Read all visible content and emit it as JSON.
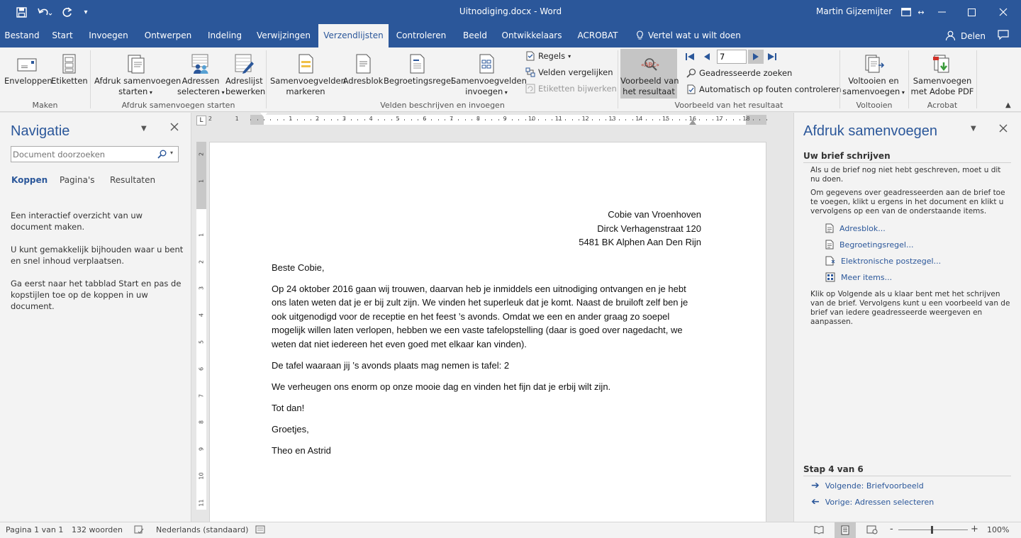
{
  "titlebar": {
    "doc_title": "Uitnodiging.docx - Word",
    "user": "Martin Gijzemijter",
    "icons": [
      "save-icon",
      "undo-icon",
      "redo-icon",
      "customize-qat-icon",
      "ribbon-display-icon",
      "resize-icon",
      "minimize-icon",
      "maximize-icon",
      "close-icon"
    ]
  },
  "tabs": {
    "items": [
      "Bestand",
      "Start",
      "Invoegen",
      "Ontwerpen",
      "Indeling",
      "Verwijzingen",
      "Verzendlijsten",
      "Controleren",
      "Beeld",
      "Ontwikkelaars",
      "ACROBAT"
    ],
    "active": "Verzendlijsten",
    "tell_me": "Vertel wat u wilt doen",
    "share": "Delen"
  },
  "ribbon": {
    "groups": {
      "maken": "Maken",
      "afdruk_starten": "Afdruk samenvoegen starten",
      "velden": "Velden beschrijven en invoegen",
      "voorbeeld": "Voorbeeld van het resultaat",
      "voltooien": "Voltooien",
      "acrobat": "Acrobat"
    },
    "buttons": {
      "enveloppen": "Enveloppen",
      "etiketten": "Etiketten",
      "afdruk_l1": "Afdruk samenvoegen",
      "afdruk_l2": "starten",
      "adressen_l1": "Adressen",
      "adressen_l2": "selecteren",
      "adreslijst_l1": "Adreslijst",
      "adreslijst_l2": "bewerken",
      "markeren_l1": "Samenvoegvelden",
      "markeren_l2": "markeren",
      "adresblok": "Adresblok",
      "begroetingsregel": "Begroetingsregel",
      "invoegen_l1": "Samenvoegvelden",
      "invoegen_l2": "invoegen",
      "regels": "Regels",
      "velden_vergelijken": "Velden vergelijken",
      "etiketten_bijwerken": "Etiketten bijwerken",
      "voorbeeld_l1": "Voorbeeld van",
      "voorbeeld_l2": "het resultaat",
      "record_value": "7",
      "geadresseerde_zoeken": "Geadresseerde zoeken",
      "auto_controleren": "Automatisch op fouten controleren",
      "voltooien_l1": "Voltooien en",
      "voltooien_l2": "samenvoegen",
      "pdf_l1": "Samenvoegen",
      "pdf_l2": "met Adobe PDF"
    }
  },
  "navigation": {
    "title": "Navigatie",
    "search_placeholder": "Document doorzoeken",
    "tabs": [
      "Koppen",
      "Pagina's",
      "Resultaten"
    ],
    "active_tab": "Koppen",
    "text1": "Een interactief overzicht van uw document maken.",
    "text2": "U kunt gemakkelijk bijhouden waar u bent en snel inhoud verplaatsen.",
    "text3": "Ga eerst naar het tabblad Start en pas de kopstijlen toe op de koppen in uw document."
  },
  "ruler": {
    "marks": [
      "2",
      "1",
      "1",
      "2",
      "3",
      "4",
      "5",
      "6",
      "7",
      "8",
      "9",
      "10",
      "11",
      "12",
      "13",
      "14",
      "15",
      "16",
      "17",
      "18"
    ],
    "v_marks": [
      "2",
      "1",
      "1",
      "2",
      "3",
      "4",
      "5",
      "6",
      "7",
      "8",
      "9",
      "10",
      "11"
    ]
  },
  "letter": {
    "address": [
      "Cobie van Vroenhoven",
      "Dirck Verhagenstraat 120",
      "5481 BK  Alphen Aan Den Rijn"
    ],
    "greeting": "Beste Cobie,",
    "para1": "Op 24 oktober 2016 gaan wij trouwen, daarvan heb je inmiddels een uitnodiging ontvangen en je hebt ons laten weten dat je er bij zult zijn. We vinden het superleuk dat je komt. Naast de bruiloft zelf ben je ook uitgenodigd voor de receptie en het feest ’s avonds. Omdat we een en ander graag zo soepel mogelijk willen laten verlopen, hebben we een vaste tafelopstelling (daar is goed over nagedacht, we weten dat niet iedereen het even goed met elkaar kan vinden).",
    "para2": "De tafel waaraan jij ’s avonds plaats mag nemen is tafel: 2",
    "para3": "We verheugen ons enorm op onze mooie dag en vinden het fijn dat je erbij wilt zijn.",
    "para4": "Tot dan!",
    "para5": "Groetjes,",
    "signature": "Theo en Astrid"
  },
  "taskpane": {
    "title": "Afdruk samenvoegen",
    "heading": "Uw brief schrijven",
    "text1": "Als u de brief nog niet hebt geschreven, moet u dit nu doen.",
    "text2": "Om gegevens over geadresseerden aan de brief toe te voegen, klikt u ergens in het document en klikt u vervolgens op een van de onderstaande items.",
    "links": [
      "Adresblok...",
      "Begroetingsregel...",
      "Elektronische postzegel...",
      "Meer items..."
    ],
    "text3": "Klik op Volgende als u klaar bent met het schrijven van de brief. Vervolgens kunt u een voorbeeld van de brief van iedere geadresseerde weergeven en aanpassen.",
    "step": "Stap 4 van 6",
    "next": "Volgende: Briefvoorbeeld",
    "prev": "Vorige: Adressen selecteren"
  },
  "statusbar": {
    "page": "Pagina 1 van 1",
    "words": "132 woorden",
    "language": "Nederlands (standaard)",
    "zoom": "100%",
    "zoom_minus": "-",
    "zoom_plus": "+"
  },
  "colors": {
    "accent": "#2b579a",
    "ribbon": "#f3f3f3",
    "link": "#2b579a"
  }
}
